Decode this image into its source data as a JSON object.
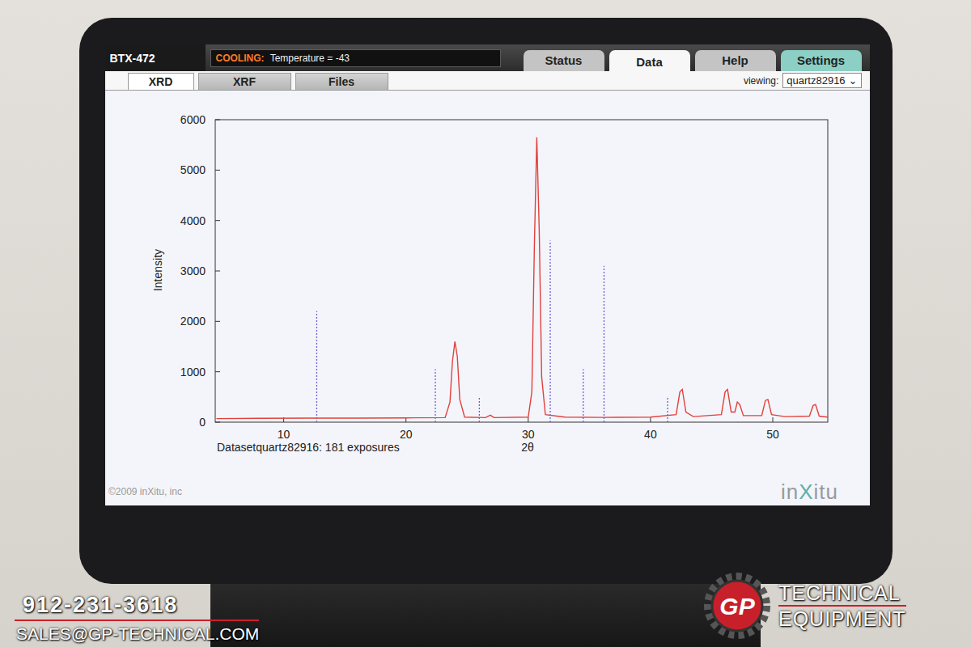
{
  "device": {
    "name": "BTX-472",
    "status_label": "COOLING:",
    "status_text": "Temperature = -43"
  },
  "tabs": [
    {
      "label": "Status",
      "selected": false,
      "color": "#c4c4c4"
    },
    {
      "label": "Data",
      "selected": true,
      "color": "#f7f7f7"
    },
    {
      "label": "Help",
      "selected": false,
      "color": "#c4c4c4"
    },
    {
      "label": "Settings",
      "selected": false,
      "color": "#8ccfc4"
    }
  ],
  "subtabs": [
    {
      "label": "XRD",
      "selected": true
    },
    {
      "label": "XRF",
      "selected": false
    },
    {
      "label": "Files",
      "selected": false
    }
  ],
  "viewing": {
    "label": "viewing:",
    "value": "quartz82916",
    "arrow": "⌄"
  },
  "chart": {
    "y_label": "Intensity",
    "x_label": "2θ",
    "caption": "Datasetquartz82916: 181 exposures",
    "y_ticks": [
      "0",
      "1000",
      "2000",
      "3000",
      "4000",
      "5000",
      "6000"
    ],
    "x_ticks": [
      "10",
      "20",
      "30",
      "40",
      "50"
    ],
    "x_range": [
      4.4,
      54.5
    ],
    "y_range": [
      0,
      6000
    ],
    "series": [
      {
        "name": "measured",
        "color": "#e2403a",
        "two_theta": [
          4.5,
          8,
          12,
          16,
          20,
          23.2,
          23.6,
          23.8,
          24.0,
          24.2,
          24.4,
          24.8,
          26.5,
          26.9,
          27.2,
          30.0,
          30.3,
          30.5,
          30.7,
          30.9,
          31.1,
          31.4,
          33,
          36,
          40,
          42.1,
          42.4,
          42.6,
          42.9,
          43.5,
          45.8,
          46.1,
          46.3,
          46.6,
          46.9,
          47.1,
          47.3,
          47.6,
          49.1,
          49.4,
          49.6,
          49.9,
          51,
          53.0,
          53.3,
          53.5,
          53.8,
          54.5
        ],
        "intensity": [
          70,
          75,
          80,
          80,
          85,
          90,
          400,
          1200,
          1600,
          1300,
          450,
          100,
          90,
          140,
          90,
          100,
          600,
          3500,
          5650,
          3800,
          900,
          150,
          100,
          95,
          100,
          150,
          600,
          650,
          200,
          110,
          150,
          600,
          650,
          200,
          200,
          400,
          350,
          130,
          130,
          430,
          450,
          150,
          110,
          120,
          330,
          350,
          120,
          100
        ]
      }
    ],
    "reference": {
      "color": "#6a5fd0",
      "two_theta": [
        12.7,
        22.4,
        26.0,
        31.8,
        34.5,
        36.2,
        41.4
      ],
      "intensity": [
        2200,
        1050,
        500,
        3600,
        1050,
        3100,
        500
      ]
    }
  },
  "footer": {
    "copyright": "©2009 inXitu, inc",
    "logo": [
      "in",
      "X",
      "itu"
    ]
  },
  "overlay": {
    "phone": "912-231-3618",
    "email": "SALES@GP-TECHNICAL.COM",
    "mark": "GP",
    "brand": [
      "TECHNICAL",
      "EQUIPMENT"
    ]
  }
}
